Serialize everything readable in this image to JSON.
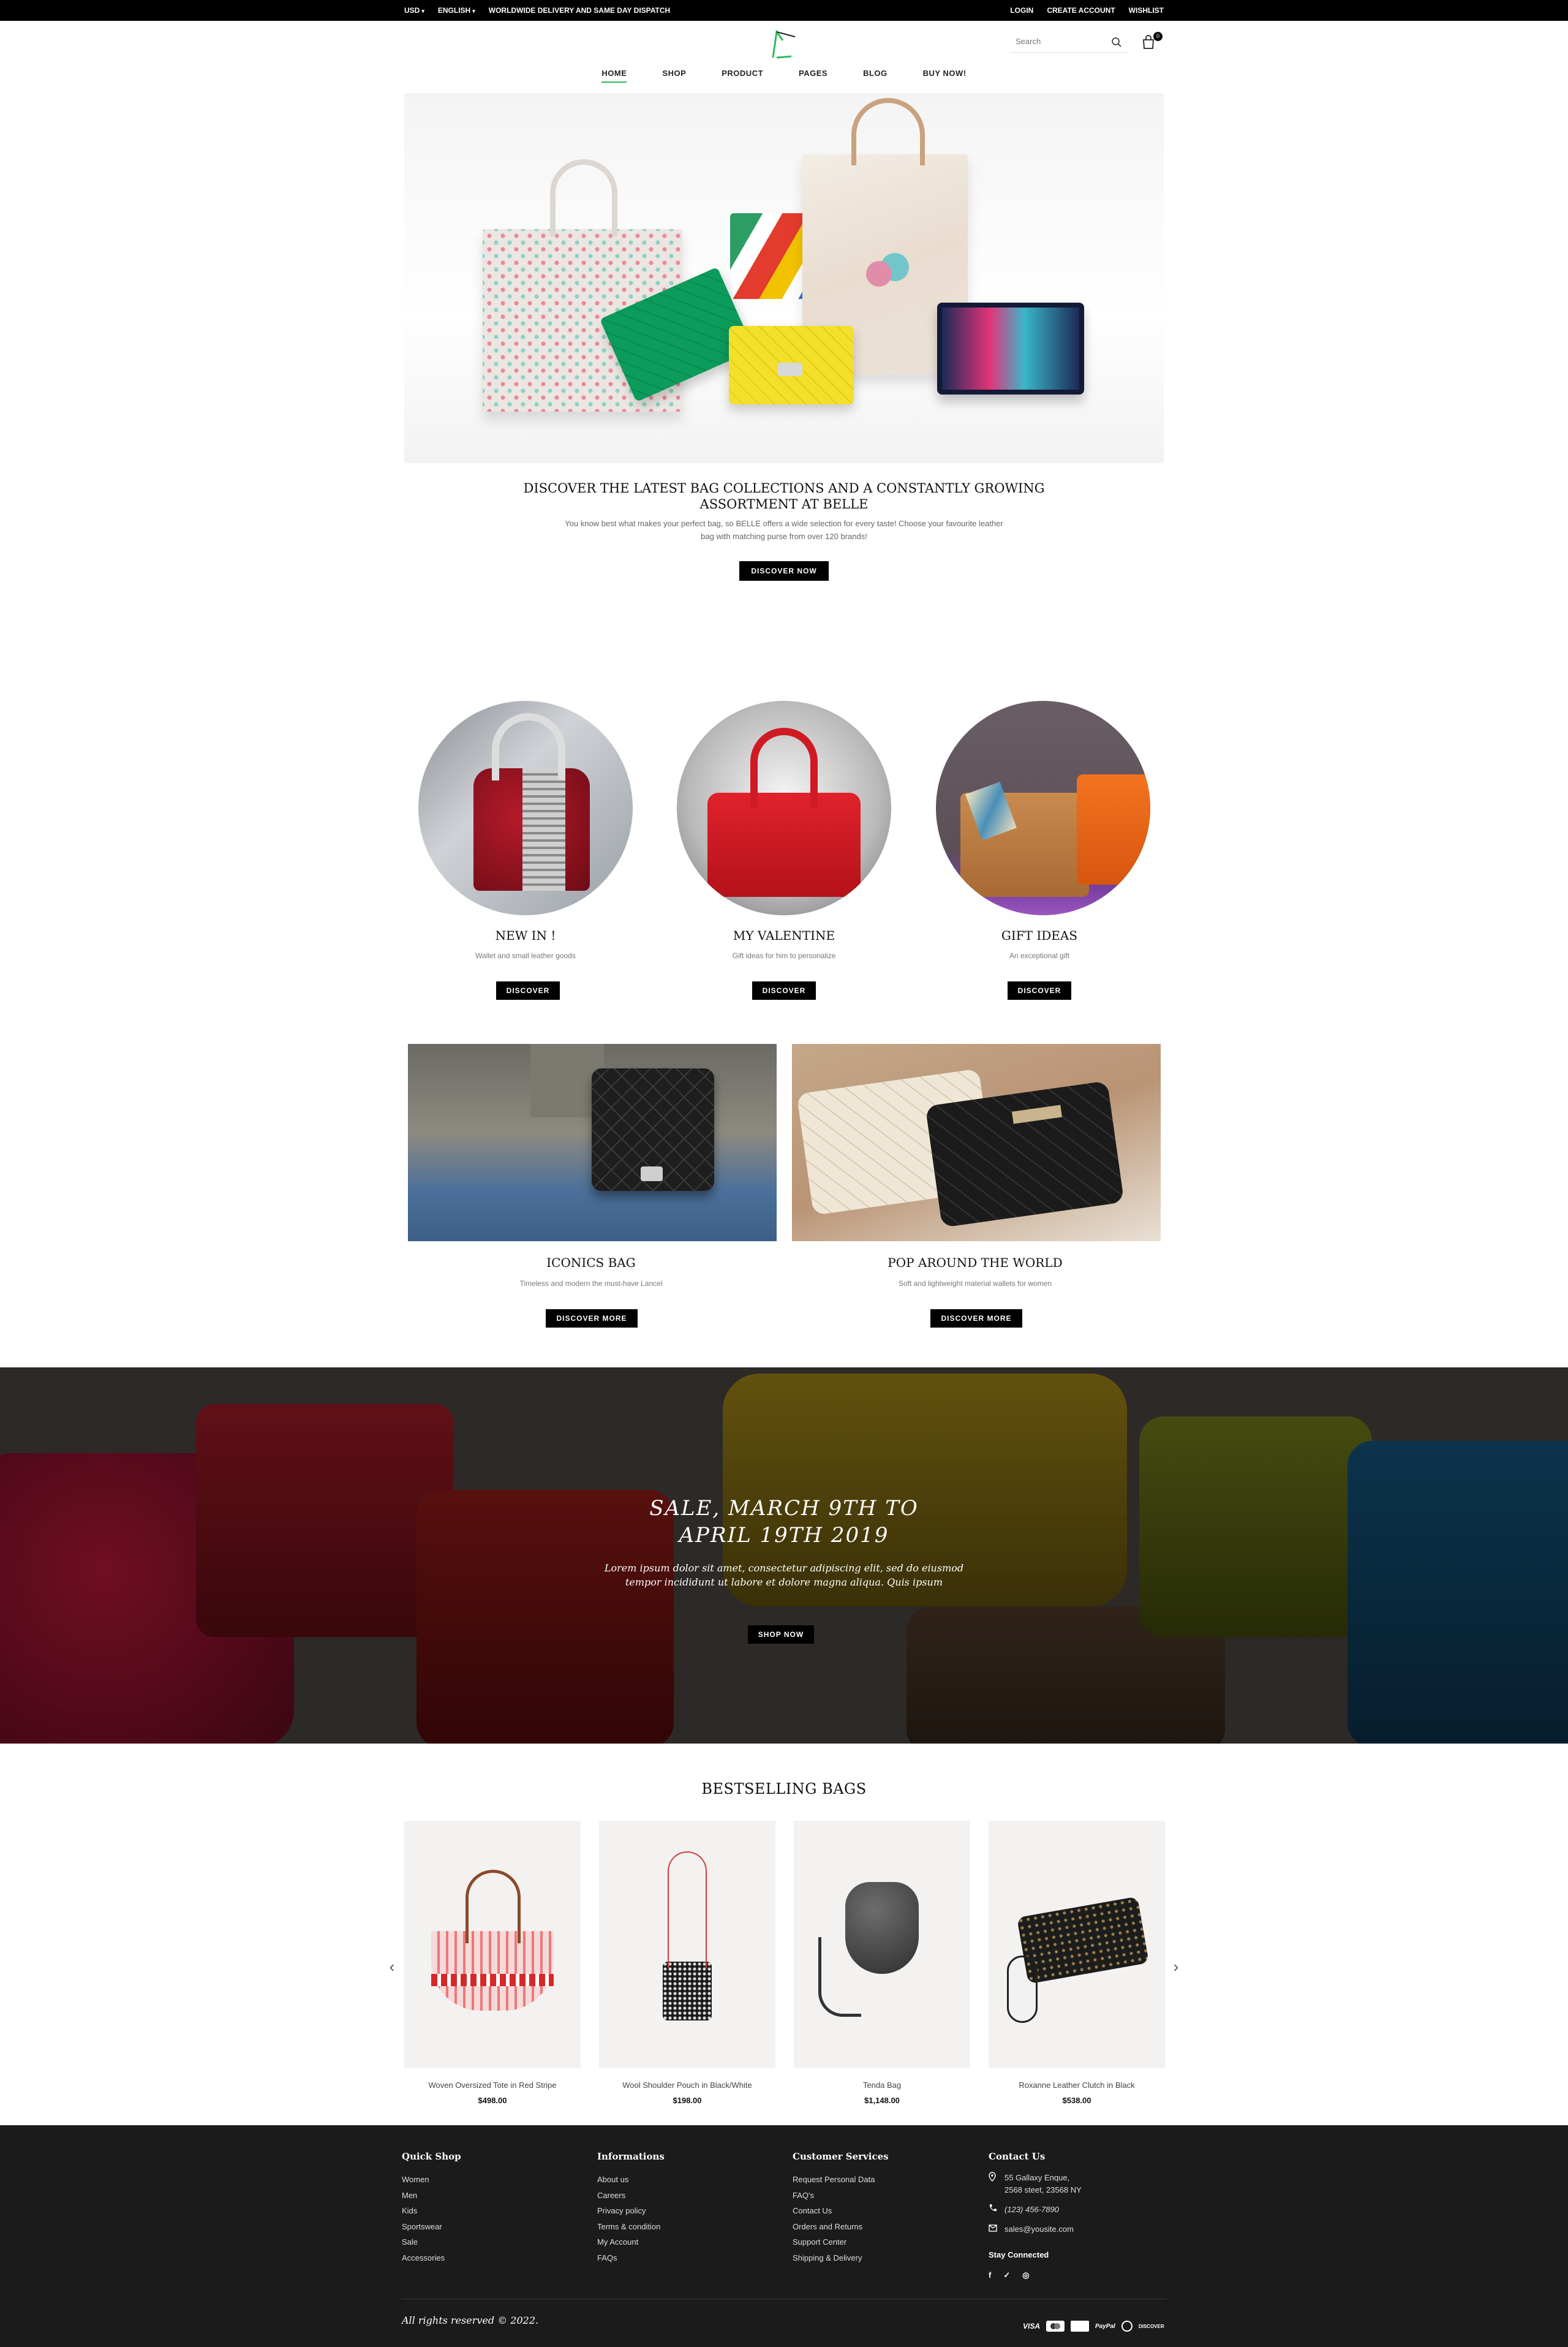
{
  "topbar": {
    "currency": "USD",
    "language": "ENGLISH",
    "promo": "WORLDWIDE DELIVERY AND SAME DAY DISPATCH",
    "login": "LOGIN",
    "create_account": "CREATE ACCOUNT",
    "wishlist": "WISHLIST"
  },
  "header": {
    "search_placeholder": "Search",
    "cart_count": "0",
    "accent_color": "#2bbb5c"
  },
  "nav": {
    "items": [
      "HOME",
      "SHOP",
      "PRODUCT",
      "PAGES",
      "BLOG",
      "BUY NOW!"
    ]
  },
  "hero": {
    "title_line1": "DISCOVER THE LATEST BAG COLLECTIONS AND A CONSTANTLY GROWING",
    "title_line2": "ASSORTMENT AT BELLE",
    "text_line1": "You know best what makes your perfect bag, so BELLE offers a wide selection for every taste! Choose your favourite leather",
    "text_line2": "bag with matching purse from over 120 brands!",
    "button": "DISCOVER NOW"
  },
  "categories": [
    {
      "title": "NEW IN !",
      "subtitle": "Wallet and small leather goods",
      "button": "DISCOVER"
    },
    {
      "title": "MY VALENTINE",
      "subtitle": "Gift ideas for him to personalize",
      "button": "DISCOVER"
    },
    {
      "title": "GIFT IDEAS",
      "subtitle": "An exceptional gift",
      "button": "DISCOVER"
    }
  ],
  "banners": [
    {
      "title": "ICONICS BAG",
      "subtitle": "Timeless and modern the must-have Lancel",
      "button": "DISCOVER MORE"
    },
    {
      "title": "POP AROUND THE WORLD",
      "subtitle": "Soft and lightweight material wallets for women",
      "button": "DISCOVER MORE"
    }
  ],
  "sale": {
    "title_line1": "SALE, MARCH 9TH TO",
    "title_line2": "APRIL 19TH 2019",
    "text_line1": "Lorem ipsum dolor sit amet, consectetur adipiscing elit, sed do eiusmod",
    "text_line2": "tempor incididunt ut labore et dolore magna aliqua. Quis ipsum",
    "button": "SHOP NOW"
  },
  "bestselling": {
    "title": "BESTSELLING BAGS",
    "products": [
      {
        "name": "Woven Oversized Tote in Red Stripe",
        "price": "$498.00"
      },
      {
        "name": "Wool Shoulder Pouch in Black/White",
        "price": "$198.00"
      },
      {
        "name": "Tenda Bag",
        "price": "$1,148.00"
      },
      {
        "name": "Roxanne Leather Clutch in Black",
        "price": "$538.00"
      }
    ]
  },
  "footer": {
    "quick_shop": {
      "title": "Quick Shop",
      "links": [
        "Women",
        "Men",
        "Kids",
        "Sportswear",
        "Sale",
        "Accessories"
      ]
    },
    "informations": {
      "title": "Informations",
      "links": [
        "About us",
        "Careers",
        "Privacy policy",
        "Terms & condition",
        "My Account",
        "FAQs"
      ]
    },
    "customer_services": {
      "title": "Customer Services",
      "links": [
        "Request Personal Data",
        "FAQ's",
        "Contact Us",
        "Orders and Returns",
        "Support Center",
        "Shipping & Delivery"
      ]
    },
    "contact": {
      "title": "Contact Us",
      "address_line1": "55 Gallaxy Enque,",
      "address_line2": "2568 steet, 23568 NY",
      "phone": "(123) 456-7890",
      "email": "sales@yousite.com",
      "stay_connected": "Stay Connected"
    },
    "copyright": "All rights reserved © 2022.",
    "payments": [
      "VISA",
      "mastercard",
      "amex",
      "PayPal",
      "diners",
      "DISCOVER"
    ]
  }
}
